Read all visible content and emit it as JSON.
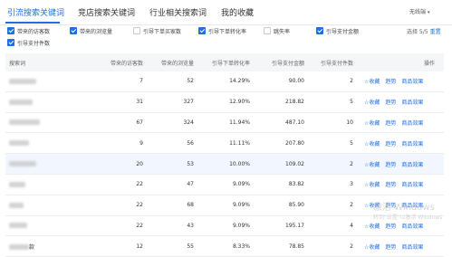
{
  "tabs": [
    {
      "label": "引流搜索关键词",
      "active": true
    },
    {
      "label": "竞店搜索关键词",
      "active": false
    },
    {
      "label": "行业相关搜索词",
      "active": false
    },
    {
      "label": "我的收藏",
      "active": false
    }
  ],
  "device_dropdown": {
    "value": "无线端"
  },
  "metric_options": [
    {
      "label": "带来的访客数",
      "checked": true
    },
    {
      "label": "带来的浏览量",
      "checked": true
    },
    {
      "label": "引导下单买家数",
      "checked": false
    },
    {
      "label": "引导下单转化率",
      "checked": true
    },
    {
      "label": "跳失率",
      "checked": false
    },
    {
      "label": "引导支付金额",
      "checked": true
    },
    {
      "label": "引导支付件数",
      "checked": true
    }
  ],
  "selection_summary": {
    "text": "选择 5/5",
    "reset_label": "重置"
  },
  "table": {
    "headers": {
      "keyword": "搜索词",
      "visitors": "带来的访客数",
      "pageviews": "带来的浏览量",
      "conversion": "引导下单转化率",
      "pay_amount": "引导支付金额",
      "pay_items": "引导支付件数",
      "actions": "操作"
    },
    "action_labels": {
      "favorite": "收藏",
      "trend": "趋势",
      "effect": "商品效果"
    },
    "rows": [
      {
        "keyword": "",
        "visitors": "7",
        "pageviews": "52",
        "conversion": "14.29%",
        "pay_amount": "90.00",
        "pay_items": "2"
      },
      {
        "keyword": "",
        "visitors": "31",
        "pageviews": "327",
        "conversion": "12.90%",
        "pay_amount": "218.82",
        "pay_items": "5"
      },
      {
        "keyword": "",
        "visitors": "67",
        "pageviews": "324",
        "conversion": "11.94%",
        "pay_amount": "487.10",
        "pay_items": "10"
      },
      {
        "keyword": "",
        "visitors": "9",
        "pageviews": "56",
        "conversion": "11.11%",
        "pay_amount": "207.80",
        "pay_items": "5"
      },
      {
        "keyword": "",
        "visitors": "20",
        "pageviews": "53",
        "conversion": "10.00%",
        "pay_amount": "109.02",
        "pay_items": "2"
      },
      {
        "keyword": "",
        "visitors": "22",
        "pageviews": "47",
        "conversion": "9.09%",
        "pay_amount": "83.82",
        "pay_items": "3"
      },
      {
        "keyword": "",
        "visitors": "22",
        "pageviews": "68",
        "conversion": "9.09%",
        "pay_amount": "85.90",
        "pay_items": "2"
      },
      {
        "keyword": "",
        "visitors": "22",
        "pageviews": "43",
        "conversion": "9.09%",
        "pay_amount": "195.17",
        "pay_items": "4"
      },
      {
        "keyword": "款",
        "visitors": "12",
        "pageviews": "55",
        "conversion": "8.33%",
        "pay_amount": "78.85",
        "pay_items": "2"
      }
    ]
  },
  "watermark": {
    "line1": "激活 Windows",
    "line2": "转到\"设置\"以激活 Windows"
  }
}
